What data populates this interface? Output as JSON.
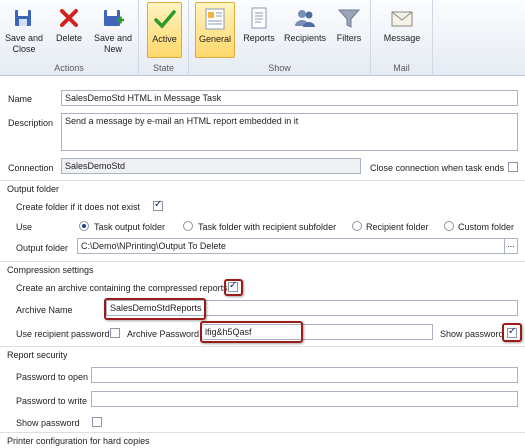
{
  "ribbon": {
    "groups": [
      {
        "label": "Actions"
      },
      {
        "label": "State"
      },
      {
        "label": "Show"
      },
      {
        "label": "Mail"
      }
    ],
    "buttons": {
      "save_close": "Save and\nClose",
      "delete": "Delete",
      "save_new": "Save and\nNew",
      "active": "Active",
      "general": "General",
      "reports": "Reports",
      "recipients": "Recipients",
      "filters": "Filters",
      "message": "Message"
    }
  },
  "form": {
    "name_label": "Name",
    "name_value": "SalesDemoStd HTML in Message Task",
    "description_label": "Description",
    "description_value": "Send a message by e-mail an HTML report embedded in it",
    "connection_label": "Connection",
    "connection_value": "SalesDemoStd",
    "close_connection_label": "Close connection when task ends",
    "output_folder_section": "Output folder",
    "create_folder_label": "Create folder if it does not exist",
    "use_label": "Use",
    "use_options": [
      {
        "label": "Task output folder",
        "selected": true
      },
      {
        "label": "Task folder with recipient subfolder",
        "selected": false
      },
      {
        "label": "Recipient folder",
        "selected": false
      },
      {
        "label": "Custom folder",
        "selected": false
      }
    ],
    "output_folder_label": "Output  folder",
    "output_folder_value": "C:\\Demo\\NPrinting\\Output To Delete",
    "ellipsis": "...",
    "compression_section": "Compression settings",
    "create_archive_label": "Create an archive containing the compressed reports",
    "archive_name_label": "Archive Name",
    "archive_name_value": "SalesDemoStdReports",
    "use_recipient_password_label": "Use recipient password",
    "archive_password_label": "Archive Password",
    "archive_password_value": "lfig&h5Qasf",
    "show_password_label": "Show password",
    "report_security_section": "Report security",
    "password_open_label": "Password to open",
    "password_write_label": "Password to write",
    "show_password2_label": "Show password",
    "printer_section": "Printer configuration for hard copies"
  },
  "colors": {
    "highlight": "#9b1b1b",
    "active_button": "#ffd86a",
    "ribbon_bg": "#e6ebf3"
  }
}
